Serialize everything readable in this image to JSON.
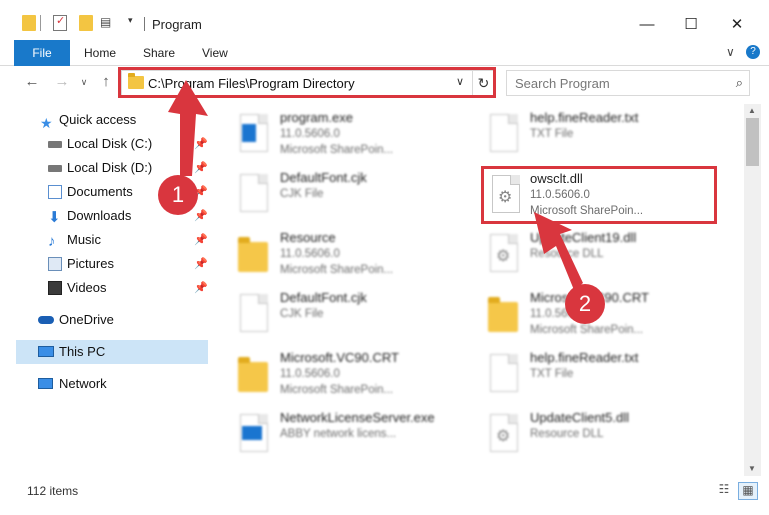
{
  "window": {
    "title": "Program",
    "minimize_glyph": "—",
    "maximize_glyph": "☐",
    "close_glyph": "✕"
  },
  "ribbon": {
    "tabs": [
      "File",
      "Home",
      "Share",
      "View"
    ],
    "collapse_glyph": "∨",
    "help_glyph": "?"
  },
  "nav": {
    "back_glyph": "←",
    "forward_glyph": "→",
    "recent_glyph": "∨",
    "up_glyph": "↑"
  },
  "address": {
    "path": "C:\\Program Files\\Program Directory",
    "chevron_glyph": "∨",
    "refresh_glyph": "↻"
  },
  "search": {
    "placeholder": "Search Program",
    "icon_glyph": "⌕"
  },
  "sidebar": {
    "items": [
      {
        "label": "Quick access",
        "icon": "star-icon",
        "pinned": false
      },
      {
        "label": "Local Disk (C:)",
        "icon": "drive-icon",
        "pinned": true
      },
      {
        "label": "Local Disk (D:)",
        "icon": "drive-icon",
        "pinned": true
      },
      {
        "label": "Documents",
        "icon": "documents-icon",
        "pinned": true
      },
      {
        "label": "Downloads",
        "icon": "download-icon",
        "pinned": true
      },
      {
        "label": "Music",
        "icon": "music-icon",
        "pinned": true
      },
      {
        "label": "Pictures",
        "icon": "pictures-icon",
        "pinned": true
      },
      {
        "label": "Videos",
        "icon": "videos-icon",
        "pinned": true
      },
      {
        "label": "OneDrive",
        "icon": "cloud-icon",
        "pinned": false
      },
      {
        "label": "This PC",
        "icon": "computer-icon",
        "pinned": false,
        "selected": true
      },
      {
        "label": "Network",
        "icon": "network-icon",
        "pinned": false
      }
    ],
    "pin_glyph": "📌"
  },
  "files": {
    "left": [
      {
        "name": "program.exe",
        "line2": "11.0.5606.0",
        "line3": "Microsoft SharePoin...",
        "icon": "exe-icon"
      },
      {
        "name": "DefaultFont.cjk",
        "line2": "CJK File",
        "line3": "",
        "icon": "document-icon"
      },
      {
        "name": "Resource",
        "line2": "11.0.5606.0",
        "line3": "Microsoft SharePoin...",
        "icon": "folder-icon"
      },
      {
        "name": "DefaultFont.cjk",
        "line2": "CJK File",
        "line3": "",
        "icon": "document-icon"
      },
      {
        "name": "Microsoft.VC90.CRT",
        "line2": "11.0.5606.0",
        "line3": "Microsoft SharePoin...",
        "icon": "folder-icon"
      },
      {
        "name": "NetworkLicenseServer.exe",
        "line2": "ABBY network licens...",
        "line3": "",
        "icon": "exe-icon"
      }
    ],
    "right": [
      {
        "name": "help.fineReader.txt",
        "line2": "TXT File",
        "line3": "",
        "icon": "document-icon"
      },
      {
        "name": "UpdateClient19.dll",
        "line2": "Resource DLL",
        "line3": "",
        "icon": "dll-gear-icon"
      },
      {
        "name": "Microsoft.VC90.CRT",
        "line2": "11.0.5606.0",
        "line3": "Microsoft SharePoin...",
        "icon": "folder-icon"
      },
      {
        "name": "help.fineReader.txt",
        "line2": "TXT File",
        "line3": "",
        "icon": "document-icon"
      },
      {
        "name": "UpdateClient5.dll",
        "line2": "Resource DLL",
        "line3": "",
        "icon": "dll-gear-icon"
      }
    ],
    "highlighted": {
      "name": "owsclt.dll",
      "line2": "11.0.5606.0",
      "line3": "Microsoft SharePoin...",
      "icon": "dll-gear-icon"
    }
  },
  "status": {
    "item_count": "112 items",
    "details_view_glyph": "☷",
    "tiles_view_glyph": "▦"
  },
  "callouts": {
    "badge1": "1",
    "badge2": "2",
    "color": "#d9363e"
  },
  "colors": {
    "accent": "#1979ca",
    "selection": "#cce4f7",
    "folder": "#f3c542"
  }
}
